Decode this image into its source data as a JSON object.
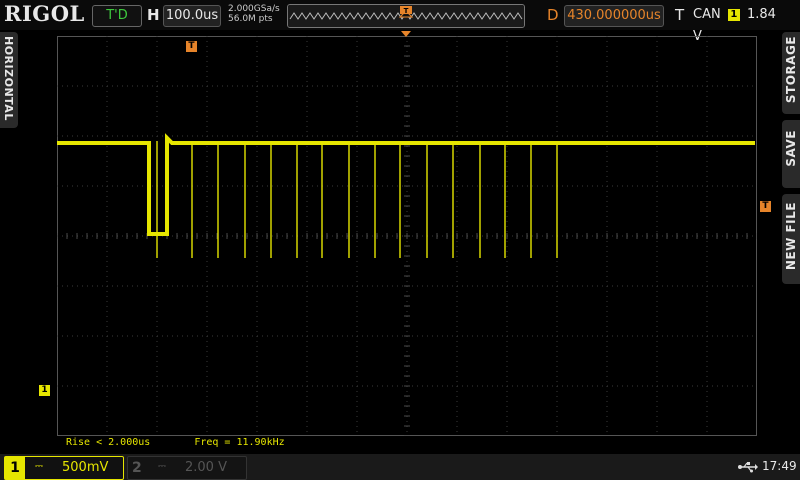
{
  "header": {
    "brand": "RIGOL",
    "run_status": "T'D",
    "horizontal_label": "H",
    "timebase": "100.0us",
    "sample_rate": "2.000GSa/s",
    "memory_depth": "56.0M pts",
    "delay_label": "D",
    "delay_value": "430.000000us",
    "trigger_label": "T",
    "trigger_source": "CAN",
    "trigger_channel": "1",
    "trigger_level": "1.84 V"
  },
  "side_menus": {
    "left": "HORIZONTAL",
    "right": [
      "STORAGE",
      "SAVE",
      "NEW FILE"
    ]
  },
  "measurements": {
    "rise": "Rise < 2.000us",
    "freq": "Freq = 11.90kHz"
  },
  "channels": [
    {
      "number": "1",
      "coupling": "⎓",
      "scale": "500mV",
      "active": true
    },
    {
      "number": "2",
      "coupling": "⎓",
      "scale": "2.00 V",
      "active": false
    }
  ],
  "markers": {
    "trigger_position": "T",
    "trigger_level": "T",
    "ch1_ground": "1"
  },
  "clock": "17:49",
  "colors": {
    "ch1": "#e6e600",
    "trigger": "#e6842a",
    "grid": "#3a3a3a",
    "run_status": "#3ec93e"
  },
  "icons": {
    "usb": "usb-icon"
  }
}
